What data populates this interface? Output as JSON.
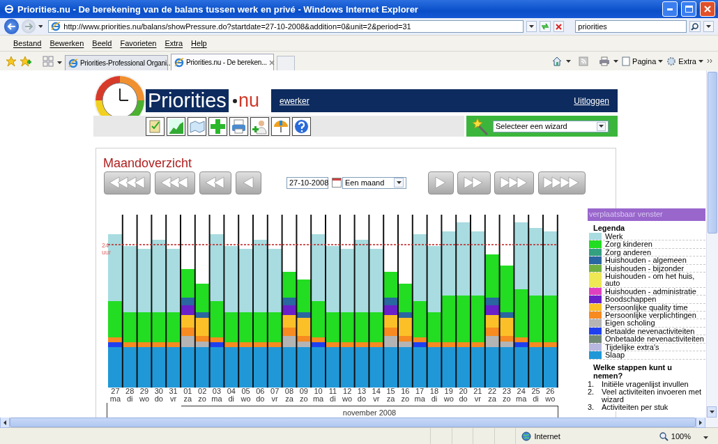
{
  "window": {
    "title": "Priorities.nu - De berekening van de balans tussen werk en privé - Windows Internet Explorer"
  },
  "browser": {
    "address": "http://www.priorities.nu/balans/showPressure.do?startdate=27-10-2008&addition=0&unit=2&period=31",
    "search": "priorities",
    "menu": [
      "Bestand",
      "Bewerken",
      "Beeld",
      "Favorieten",
      "Extra",
      "Help"
    ],
    "tabs": [
      {
        "label": "Priorities-Professional Organi...",
        "selected": false
      },
      {
        "label": "Priorities.nu - De bereken...",
        "selected": true
      }
    ],
    "commands": [
      "Pagina",
      "Extra"
    ]
  },
  "site": {
    "logo": "Priorities",
    "logo_suffix": "nu",
    "user": "ewerker",
    "logout": "Uitloggen",
    "wizard": "Selecteer een wizard"
  },
  "overview": {
    "title": "Maandoverzicht",
    "date": "27-10-2008",
    "period": "Een maand",
    "chart": {
      "reference": "24",
      "reference_unit": "uur",
      "month": "november 2008",
      "days": [
        {
          "date": "27",
          "weekday": "ma"
        },
        {
          "date": "28",
          "weekday": "di"
        },
        {
          "date": "29",
          "weekday": "wo"
        },
        {
          "date": "30",
          "weekday": "do"
        },
        {
          "date": "31",
          "weekday": "vr"
        },
        {
          "date": "01",
          "weekday": "za"
        },
        {
          "date": "02",
          "weekday": "zo"
        },
        {
          "date": "03",
          "weekday": "ma"
        },
        {
          "date": "04",
          "weekday": "di"
        },
        {
          "date": "05",
          "weekday": "wo"
        },
        {
          "date": "06",
          "weekday": "do"
        },
        {
          "date": "07",
          "weekday": "vr"
        },
        {
          "date": "08",
          "weekday": "za"
        },
        {
          "date": "09",
          "weekday": "zo"
        },
        {
          "date": "10",
          "weekday": "ma"
        },
        {
          "date": "11",
          "weekday": "di"
        },
        {
          "date": "12",
          "weekday": "wo"
        },
        {
          "date": "13",
          "weekday": "do"
        },
        {
          "date": "14",
          "weekday": "vr"
        },
        {
          "date": "15",
          "weekday": "za"
        },
        {
          "date": "16",
          "weekday": "zo"
        },
        {
          "date": "17",
          "weekday": "ma"
        },
        {
          "date": "18",
          "weekday": "di"
        },
        {
          "date": "19",
          "weekday": "wo"
        },
        {
          "date": "20",
          "weekday": "do"
        },
        {
          "date": "21",
          "weekday": "vr"
        },
        {
          "date": "22",
          "weekday": "za"
        },
        {
          "date": "23",
          "weekday": "zo"
        },
        {
          "date": "24",
          "weekday": "ma"
        },
        {
          "date": "25",
          "weekday": "di"
        },
        {
          "date": "26",
          "weekday": "wo"
        }
      ]
    }
  },
  "legend_panel": {
    "title": "verplaatsbaar venster",
    "heading": "Legenda",
    "items": [
      {
        "label": "Werk",
        "color": "#a8dce0"
      },
      {
        "label": "Zorg kinderen",
        "color": "#22dd22"
      },
      {
        "label": "Zorg anderen",
        "color": "#33a080"
      },
      {
        "label": "Huishouden - algemeen",
        "color": "#2a66a0"
      },
      {
        "label": "Huishouden - bijzonder",
        "color": "#70b040"
      },
      {
        "label": "Huishouden - om het huis, auto",
        "color": "#eee855"
      },
      {
        "label": "Huishouden - administratie",
        "color": "#e040c0"
      },
      {
        "label": "Boodschappen",
        "color": "#6a20c8"
      },
      {
        "label": "Persoonlijke quality time",
        "color": "#fbc028"
      },
      {
        "label": "Persoonlijke verplichtingen",
        "color": "#f78a20"
      },
      {
        "label": "Eigen scholing",
        "color": "#b4b4b4"
      },
      {
        "label": "Betaalde nevenactiviteiten",
        "color": "#2040f0"
      },
      {
        "label": "Onbetaalde nevenactiviteiten",
        "color": "#708878"
      },
      {
        "label": "Tijdelijke extra's",
        "color": "#b8b8e0"
      },
      {
        "label": "Slaap",
        "color": "#2098d8"
      }
    ],
    "steps_heading": "Welke stappen kunt u nemen?",
    "steps": [
      {
        "number": "1.",
        "text": "Initiële vragenlijst invullen"
      },
      {
        "number": "2.",
        "text": "Veel activiteiten invoeren met wizard"
      },
      {
        "number": "3.",
        "text": "Activiteiten per stuk"
      }
    ]
  },
  "status": {
    "zone": "Internet",
    "zoom": "100%"
  }
}
